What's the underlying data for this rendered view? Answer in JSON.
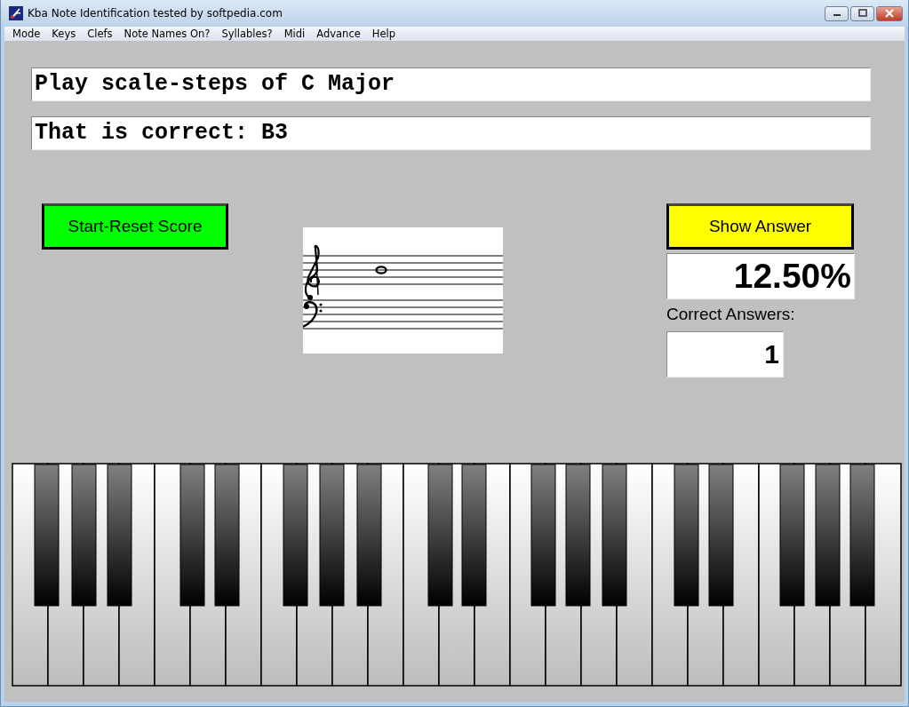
{
  "window": {
    "title": "Kba Note Identification tested by softpedia.com"
  },
  "menu": [
    "Mode",
    "Keys",
    "Clefs",
    "Note Names On?",
    "Syllables?",
    "Midi",
    "Advance",
    "Help"
  ],
  "prompt": {
    "value": "Play scale-steps of C Major"
  },
  "feedback": {
    "value": "That is correct: B3"
  },
  "start_button": "Start-Reset Score",
  "show_answer_button": "Show Answer",
  "score": {
    "percent": "12.50%",
    "label": "Correct Answers:",
    "count": "1"
  }
}
